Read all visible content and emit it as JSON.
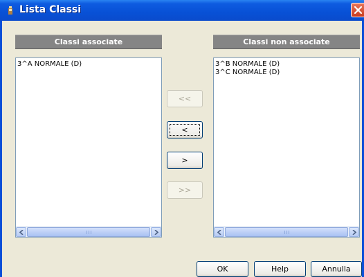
{
  "window": {
    "title": "Lista Classi"
  },
  "left_panel": {
    "header": "Classi associate",
    "items": [
      "3^A NORMALE (D)"
    ]
  },
  "right_panel": {
    "header": "Classi non associate",
    "items": [
      "3^B NORMALE (D)",
      "3^C NORMALE (D)"
    ]
  },
  "transfer_buttons": {
    "move_all_left": "<<",
    "move_left": "<",
    "move_right": ">",
    "move_all_right": ">>"
  },
  "footer_buttons": {
    "ok": "OK",
    "help": "Help",
    "cancel": "Annulla"
  }
}
